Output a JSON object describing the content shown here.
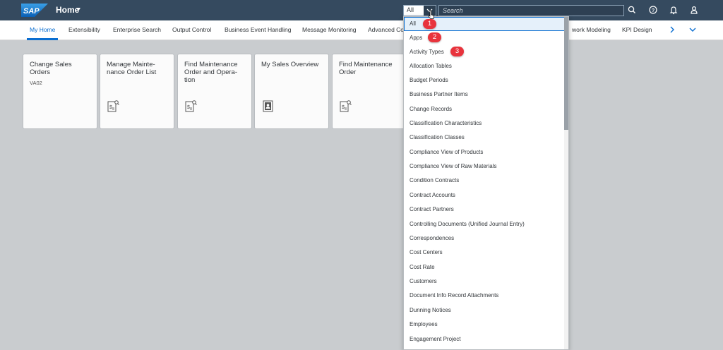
{
  "shell": {
    "logo_text": "SAP",
    "home_title": "Home",
    "scope_value": "All",
    "search_placeholder": "Search",
    "icons": [
      "search-icon",
      "help-icon",
      "notification-bell-icon",
      "user-icon"
    ]
  },
  "colors": {
    "shellbar": "#354a5f",
    "accent": "#0a6ed1",
    "badge": "#e8333c",
    "background": "#c9cccf"
  },
  "nav": {
    "tabs": [
      {
        "label": "My Home"
      },
      {
        "label": "Extensibility"
      },
      {
        "label": "Enterprise Search"
      },
      {
        "label": "Output Control"
      },
      {
        "label": "Business Event Handling"
      },
      {
        "label": "Message Monitoring"
      },
      {
        "label": "Advanced Co"
      },
      {
        "label": "work Modeling"
      },
      {
        "label": "KPI Design"
      }
    ]
  },
  "tiles": [
    {
      "title": "Change Sales Orders",
      "subtitle": "VA02",
      "icon": ""
    },
    {
      "title": "Manage Mainte-nance Order List",
      "subtitle": "",
      "icon": "document-search-icon"
    },
    {
      "title": "Find Maintenance Order and Opera-tion",
      "subtitle": "",
      "icon": "document-search-icon"
    },
    {
      "title": "My Sales Overview",
      "subtitle": "",
      "icon": "sales-document-icon"
    },
    {
      "title": "Find Maintenance Order",
      "subtitle": "",
      "icon": "document-search-icon"
    }
  ],
  "dropdown": {
    "items": [
      "All",
      "Apps",
      "Activity Types",
      "Allocation Tables",
      "Budget Periods",
      "Business Partner Items",
      "Change Records",
      "Classification Characteristics",
      "Classification Classes",
      "Compliance View of Products",
      "Compliance View of Raw Materials",
      "Condition Contracts",
      "Contract Accounts",
      "Contract Partners",
      "Controlling Documents (Unified Journal Entry)",
      "Correspondences",
      "Cost Centers",
      "Cost Rate",
      "Customers",
      "Document Info Record Attachments",
      "Dunning Notices",
      "Employees",
      "Engagement Project"
    ]
  },
  "badges": [
    "1",
    "2",
    "3"
  ]
}
